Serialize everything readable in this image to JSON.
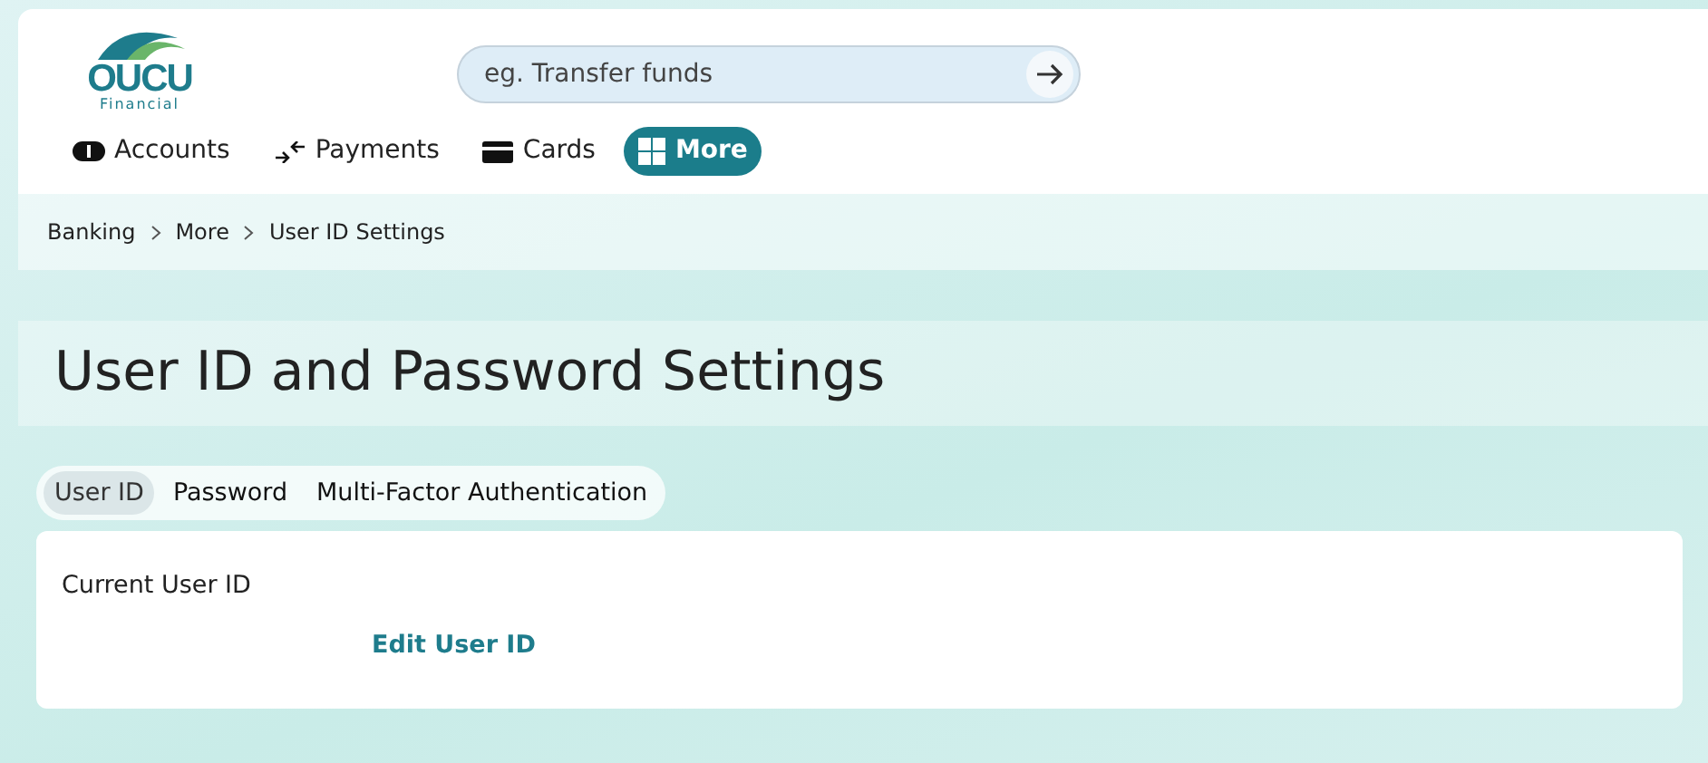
{
  "logo": {
    "name": "OUCU",
    "subtitle": "Financial"
  },
  "search": {
    "placeholder": "eg. Transfer funds"
  },
  "nav": [
    {
      "label": "Accounts",
      "kind": "accounts",
      "selected": false
    },
    {
      "label": "Payments",
      "kind": "payments",
      "selected": false
    },
    {
      "label": "Cards",
      "kind": "cards",
      "selected": false
    },
    {
      "label": "More",
      "kind": "more",
      "selected": true
    }
  ],
  "breadcrumb": [
    "Banking",
    "More",
    "User ID Settings"
  ],
  "title": "User ID and Password Settings",
  "tabs": [
    {
      "label": "User ID",
      "selected": true
    },
    {
      "label": "Password",
      "selected": false
    },
    {
      "label": "Multi-Factor Authentication",
      "selected": false
    }
  ],
  "panel": {
    "label": "Current User ID",
    "link": "Edit User ID"
  }
}
